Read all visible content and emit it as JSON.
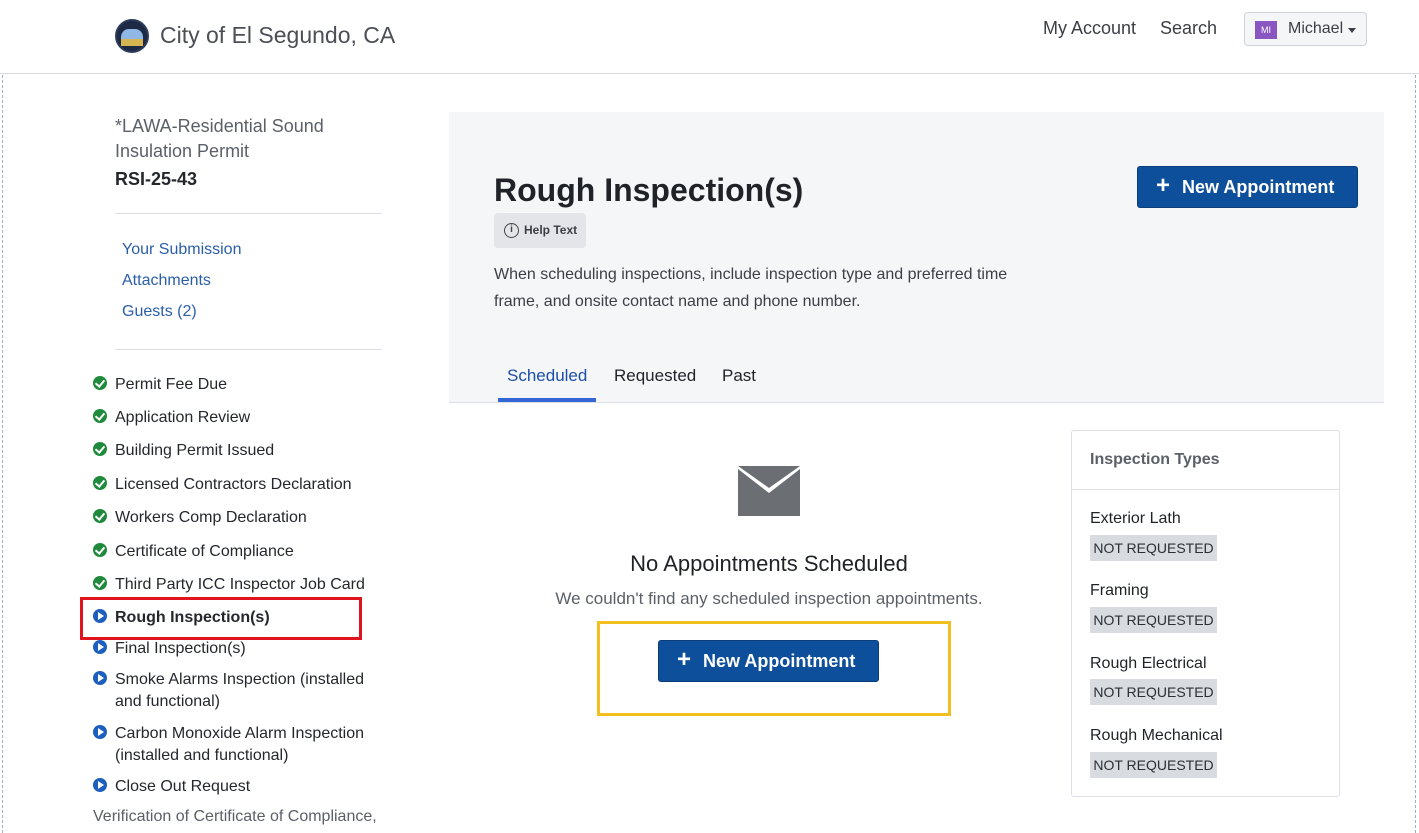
{
  "header": {
    "site_title": "City of El Segundo, CA",
    "nav": {
      "my_account": "My Account",
      "search": "Search"
    },
    "user": {
      "initials": "MI",
      "name": "Michael"
    }
  },
  "sidebar": {
    "permit_type": "*LAWA-Residential Sound Insulation Permit",
    "permit_number": "RSI-25-43",
    "links": [
      "Your Submission",
      "Attachments",
      "Guests (2)"
    ],
    "steps": [
      {
        "label": "Permit Fee Due",
        "status": "complete"
      },
      {
        "label": "Application Review",
        "status": "complete"
      },
      {
        "label": "Building Permit Issued",
        "status": "complete"
      },
      {
        "label": "Licensed Contractors Declaration",
        "status": "complete"
      },
      {
        "label": "Workers Comp Declaration",
        "status": "complete"
      },
      {
        "label": "Certificate of Compliance",
        "status": "complete"
      },
      {
        "label": "Third Party ICC Inspector Job Card",
        "status": "complete"
      },
      {
        "label": "Rough Inspection(s)",
        "status": "current"
      },
      {
        "label": "Final Inspection(s)",
        "status": "pending"
      },
      {
        "label": "Smoke Alarms Inspection (installed and functional)",
        "status": "pending"
      },
      {
        "label": "Carbon Monoxide Alarm Inspection (installed and functional)",
        "status": "pending"
      },
      {
        "label": "Close Out Request",
        "status": "pending"
      }
    ],
    "trailing_text": "Verification of Certificate of Compliance,"
  },
  "main": {
    "title": "Rough Inspection(s)",
    "help_text_label": "Help Text",
    "instructions": "When scheduling inspections, include inspection type and preferred time frame, and onsite contact name and phone number.",
    "new_appointment_label": "New Appointment",
    "tabs": [
      "Scheduled",
      "Requested",
      "Past"
    ],
    "active_tab": "Scheduled",
    "empty_state": {
      "title": "No Appointments Scheduled",
      "subtitle": "We couldn't find any scheduled inspection appointments.",
      "button_label": "New Appointment"
    }
  },
  "inspection_types": {
    "title": "Inspection Types",
    "items": [
      {
        "name": "Exterior Lath",
        "status": "NOT REQUESTED"
      },
      {
        "name": "Framing",
        "status": "NOT REQUESTED"
      },
      {
        "name": "Rough Electrical",
        "status": "NOT REQUESTED"
      },
      {
        "name": "Rough Mechanical",
        "status": "NOT REQUESTED"
      }
    ]
  },
  "colors": {
    "primary_button": "#0e4f9c",
    "link": "#2a5ea8",
    "complete_icon": "#1f8a3b",
    "pending_icon": "#1d5fbf",
    "highlight_red": "#e0141d",
    "highlight_yellow": "#f2bf1f"
  }
}
